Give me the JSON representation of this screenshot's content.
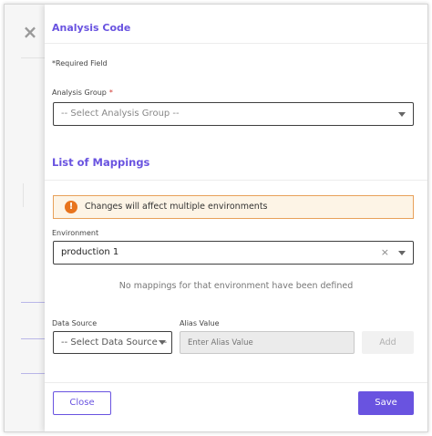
{
  "close_icon": "×",
  "title": "Analysis Code",
  "required_note": "*Required Field",
  "analysis_group": {
    "label": "Analysis Group",
    "required_mark": "*",
    "placeholder": "-- Select Analysis Group --"
  },
  "mappings": {
    "title": "List of Mappings",
    "warning": "Changes will affect multiple environments",
    "warning_icon": "!",
    "environment_label": "Environment",
    "environment_value": "production 1",
    "clear_icon": "×",
    "empty_message": "No mappings for that environment have been defined",
    "data_source_label": "Data Source",
    "data_source_placeholder": "-- Select Data Source --",
    "alias_label": "Alias Value",
    "alias_placeholder": "Enter Alias Value",
    "add_label": "Add"
  },
  "footer": {
    "close_label": "Close",
    "save_label": "Save"
  },
  "colors": {
    "accent": "#6953e0",
    "warning_border": "#e8a15a",
    "warning_bg": "#fdf4e6",
    "warning_icon": "#e8741e"
  }
}
